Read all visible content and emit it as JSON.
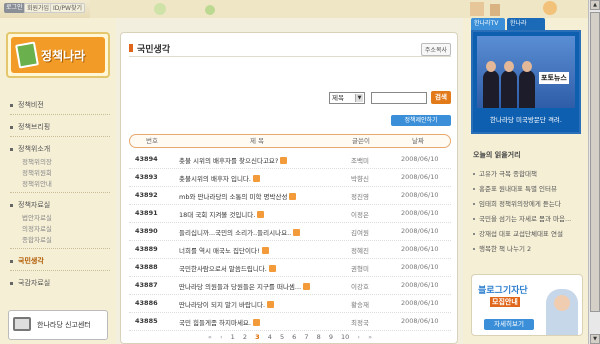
{
  "topbar": {
    "login": "로그인",
    "join": "회원가입",
    "find": "ID/PW찾기"
  },
  "sidebar": {
    "logo_text": "정책나라",
    "menu": [
      {
        "label": "정책비전",
        "type": "item"
      },
      {
        "label": "정책브리핑",
        "type": "item"
      },
      {
        "label": "정책위소개",
        "type": "item"
      },
      {
        "label": "정책위의장",
        "type": "sub"
      },
      {
        "label": "정책위원회",
        "type": "sub"
      },
      {
        "label": "정책위안내",
        "type": "sub"
      },
      {
        "label": "정책자료실",
        "type": "item"
      },
      {
        "label": "법안자료실",
        "type": "sub"
      },
      {
        "label": "의정자료실",
        "type": "sub"
      },
      {
        "label": "종합자료실",
        "type": "sub"
      },
      {
        "label": "국민생각",
        "type": "item",
        "active": true
      },
      {
        "label": "국감자료실",
        "type": "item"
      }
    ],
    "report_center": "한나라당 신고센터"
  },
  "main": {
    "title": "국민생각",
    "copy_url": "주소복사",
    "search": {
      "select_value": "제목",
      "button": "검색"
    },
    "propose_button": "정책제안하기",
    "table": {
      "headers": [
        "번호",
        "제 목",
        "글쓴이",
        "날짜"
      ],
      "rows": [
        {
          "num": "43894",
          "title": "촛불 시위의 배후자를 찾으신다고요?",
          "author": "조백미",
          "date": "2008/06/10"
        },
        {
          "num": "43893",
          "title": "촛불시위의 배후자 입니다.",
          "author": "박향신",
          "date": "2008/06/10"
        },
        {
          "num": "43892",
          "title": "mb와 딴나라당의 소통의 미학 명박산성",
          "author": "정진영",
          "date": "2008/06/10"
        },
        {
          "num": "43891",
          "title": "18대 국회 지켜볼 것입니다.",
          "author": "이정은",
          "date": "2008/06/10"
        },
        {
          "num": "43890",
          "title": "들리십니까...국민의 소리가..들리시나요..",
          "author": "김여원",
          "date": "2008/06/10"
        },
        {
          "num": "43889",
          "title": "너희를 역시 매국노 집단이다!",
          "author": "정혜진",
          "date": "2008/06/10"
        },
        {
          "num": "43888",
          "title": "국민한사람으로서 말씀드립니다.",
          "author": "권형미",
          "date": "2008/06/10"
        },
        {
          "num": "43887",
          "title": "딴나라당 의원들과 당원들은 지구를 떠나셈...",
          "author": "이강호",
          "date": "2008/06/10"
        },
        {
          "num": "43886",
          "title": "딴나라당이 되지 말기 바랍니다.",
          "author": "황승재",
          "date": "2008/06/10"
        },
        {
          "num": "43885",
          "title": "국민 힘들게좀 하지마세요.",
          "author": "최정국",
          "date": "2008/06/10"
        }
      ]
    },
    "pager": {
      "first": "«",
      "prev": "‹",
      "pages": [
        "1",
        "2",
        "3",
        "4",
        "5",
        "6",
        "7",
        "8",
        "9",
        "10"
      ],
      "current": "3",
      "next": "›",
      "last": "»"
    }
  },
  "right": {
    "tab_tv": "한나라TV",
    "tab_photo": "한나라Photo",
    "news_logo": "포토뉴스",
    "tv_caption": "한나라당 미국방문단 격려.",
    "reading_title": "오늘의 읽을거리",
    "reading_items": [
      "고유가 극복 종합대책",
      "홍준표 원내대표 특별 인터뷰",
      "임태희 정책위의장에게 듣는다",
      "국민을 섬기는 자세로 몸과 마음...",
      "강재섭 대표 교섭단체대표 연설",
      "행복한 책 나누기 2"
    ],
    "ad_title": "블로그기자단",
    "ad_sub": "모집안내",
    "ad_button": "자세히보기"
  },
  "colors": {
    "accent": "#e0661b",
    "blue": "#3a8fd8",
    "background": "#f5efd6"
  }
}
